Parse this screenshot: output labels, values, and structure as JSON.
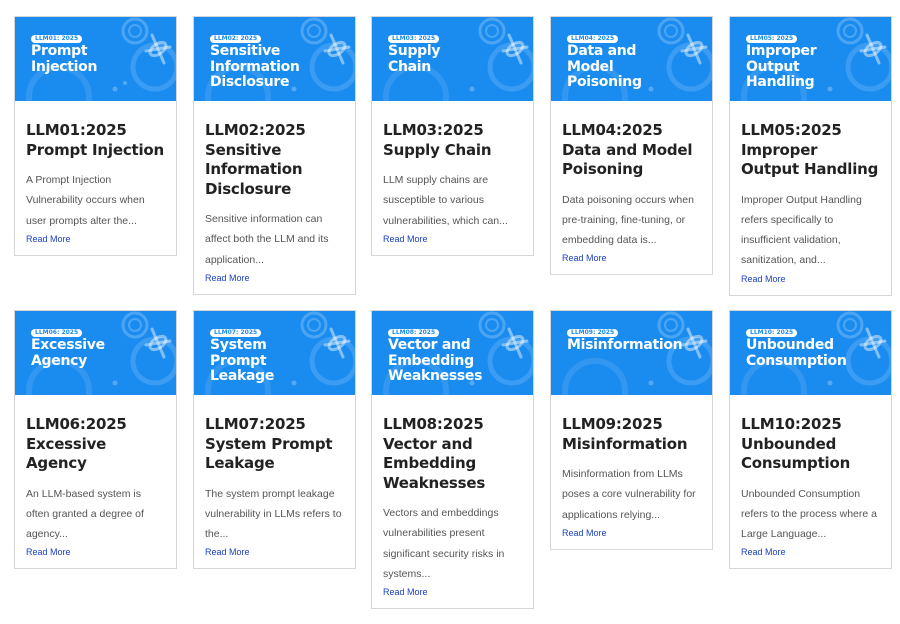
{
  "cards": [
    {
      "badge": "LLM01: 2025",
      "banner_title": "Prompt\nInjection",
      "title": "LLM01:2025 Prompt Injection",
      "description": "A Prompt Injection Vulnerability occurs when user prompts alter the...",
      "link": "Read More"
    },
    {
      "badge": "LLM02: 2025",
      "banner_title": "Sensitive\nInformation\nDisclosure",
      "title": "LLM02:2025 Sensitive Information Disclosure",
      "description": "Sensitive information can affect both the LLM and its application...",
      "link": "Read More"
    },
    {
      "badge": "LLM03: 2025",
      "banner_title": "Supply\nChain",
      "title": "LLM03:2025 Supply Chain",
      "description": "LLM supply chains are susceptible to various vulnerabilities, which can...",
      "link": "Read More"
    },
    {
      "badge": "LLM04: 2025",
      "banner_title": "Data and\nModel\nPoisoning",
      "title": "LLM04:2025 Data and Model Poisoning",
      "description": "Data poisoning occurs when pre-training, fine-tuning, or embedding data is...",
      "link": "Read More"
    },
    {
      "badge": "LLM05: 2025",
      "banner_title": "Improper\nOutput\nHandling",
      "title": "LLM05:2025 Improper Output Handling",
      "description": "Improper Output Handling refers specifically to insufficient validation, sanitization, and...",
      "link": "Read More"
    },
    {
      "badge": "LLM06: 2025",
      "banner_title": "Excessive\nAgency",
      "title": "LLM06:2025 Excessive Agency",
      "description": "An LLM-based system is often granted a degree of agency...",
      "link": "Read More"
    },
    {
      "badge": "LLM07: 2025",
      "banner_title": "System\nPrompt\nLeakage",
      "title": "LLM07:2025 System Prompt Leakage",
      "description": "The system prompt leakage vulnerability in LLMs refers to the...",
      "link": "Read More"
    },
    {
      "badge": "LLM08: 2025",
      "banner_title": "Vector and\nEmbedding\nWeaknesses",
      "title": "LLM08:2025 Vector and Embedding Weaknesses",
      "description": "Vectors and embeddings vulnerabilities present significant security risks in systems...",
      "link": "Read More"
    },
    {
      "badge": "LLM09: 2025",
      "banner_title": "Misinformation",
      "title": "LLM09:2025 Misinformation",
      "description": "Misinformation from LLMs poses a core vulnerability for applications relying...",
      "link": "Read More"
    },
    {
      "badge": "LLM10: 2025",
      "banner_title": "Unbounded\nConsumption",
      "title": "LLM10:2025 Unbounded Consumption",
      "description": "Unbounded Consumption refers to the process where a Large Language...",
      "link": "Read More"
    }
  ],
  "colors": {
    "banner": "#1a8cf0",
    "link": "#1b3fc1"
  },
  "icons": {
    "banner_logo": "wasp-logo-icon"
  }
}
